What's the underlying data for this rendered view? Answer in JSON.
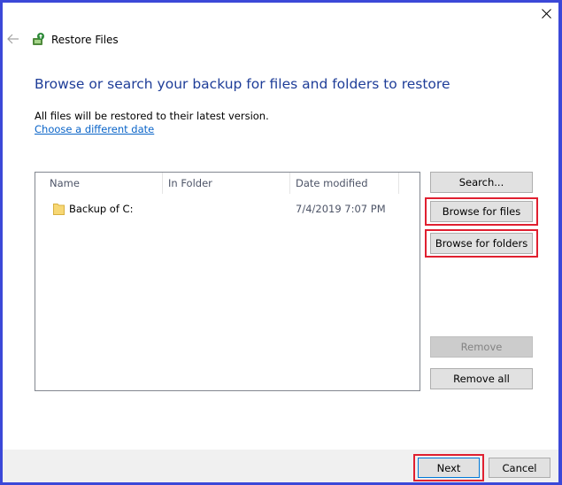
{
  "window": {
    "title": "Restore Files"
  },
  "heading": "Browse or search your backup for files and folders to restore",
  "info_text": "All files will be restored to their latest version.",
  "link_text": "Choose a different date",
  "list": {
    "columns": [
      "Name",
      "In Folder",
      "Date modified"
    ],
    "rows": [
      {
        "name": "Backup of C:",
        "in_folder": "",
        "date_modified": "7/4/2019 7:07 PM"
      }
    ]
  },
  "buttons": {
    "search": "Search...",
    "browse_files": "Browse for files",
    "browse_folders": "Browse for folders",
    "remove": "Remove",
    "remove_all": "Remove all",
    "next": "Next",
    "cancel": "Cancel"
  },
  "colors": {
    "accent_highlight": "#e02030",
    "heading": "#1e3d98",
    "link": "#0a64c8",
    "desktop_border": "#3b48d8"
  },
  "icons": {
    "close": "close-icon",
    "back": "back-arrow-icon",
    "app": "restore-files-icon",
    "folder": "folder-icon"
  }
}
